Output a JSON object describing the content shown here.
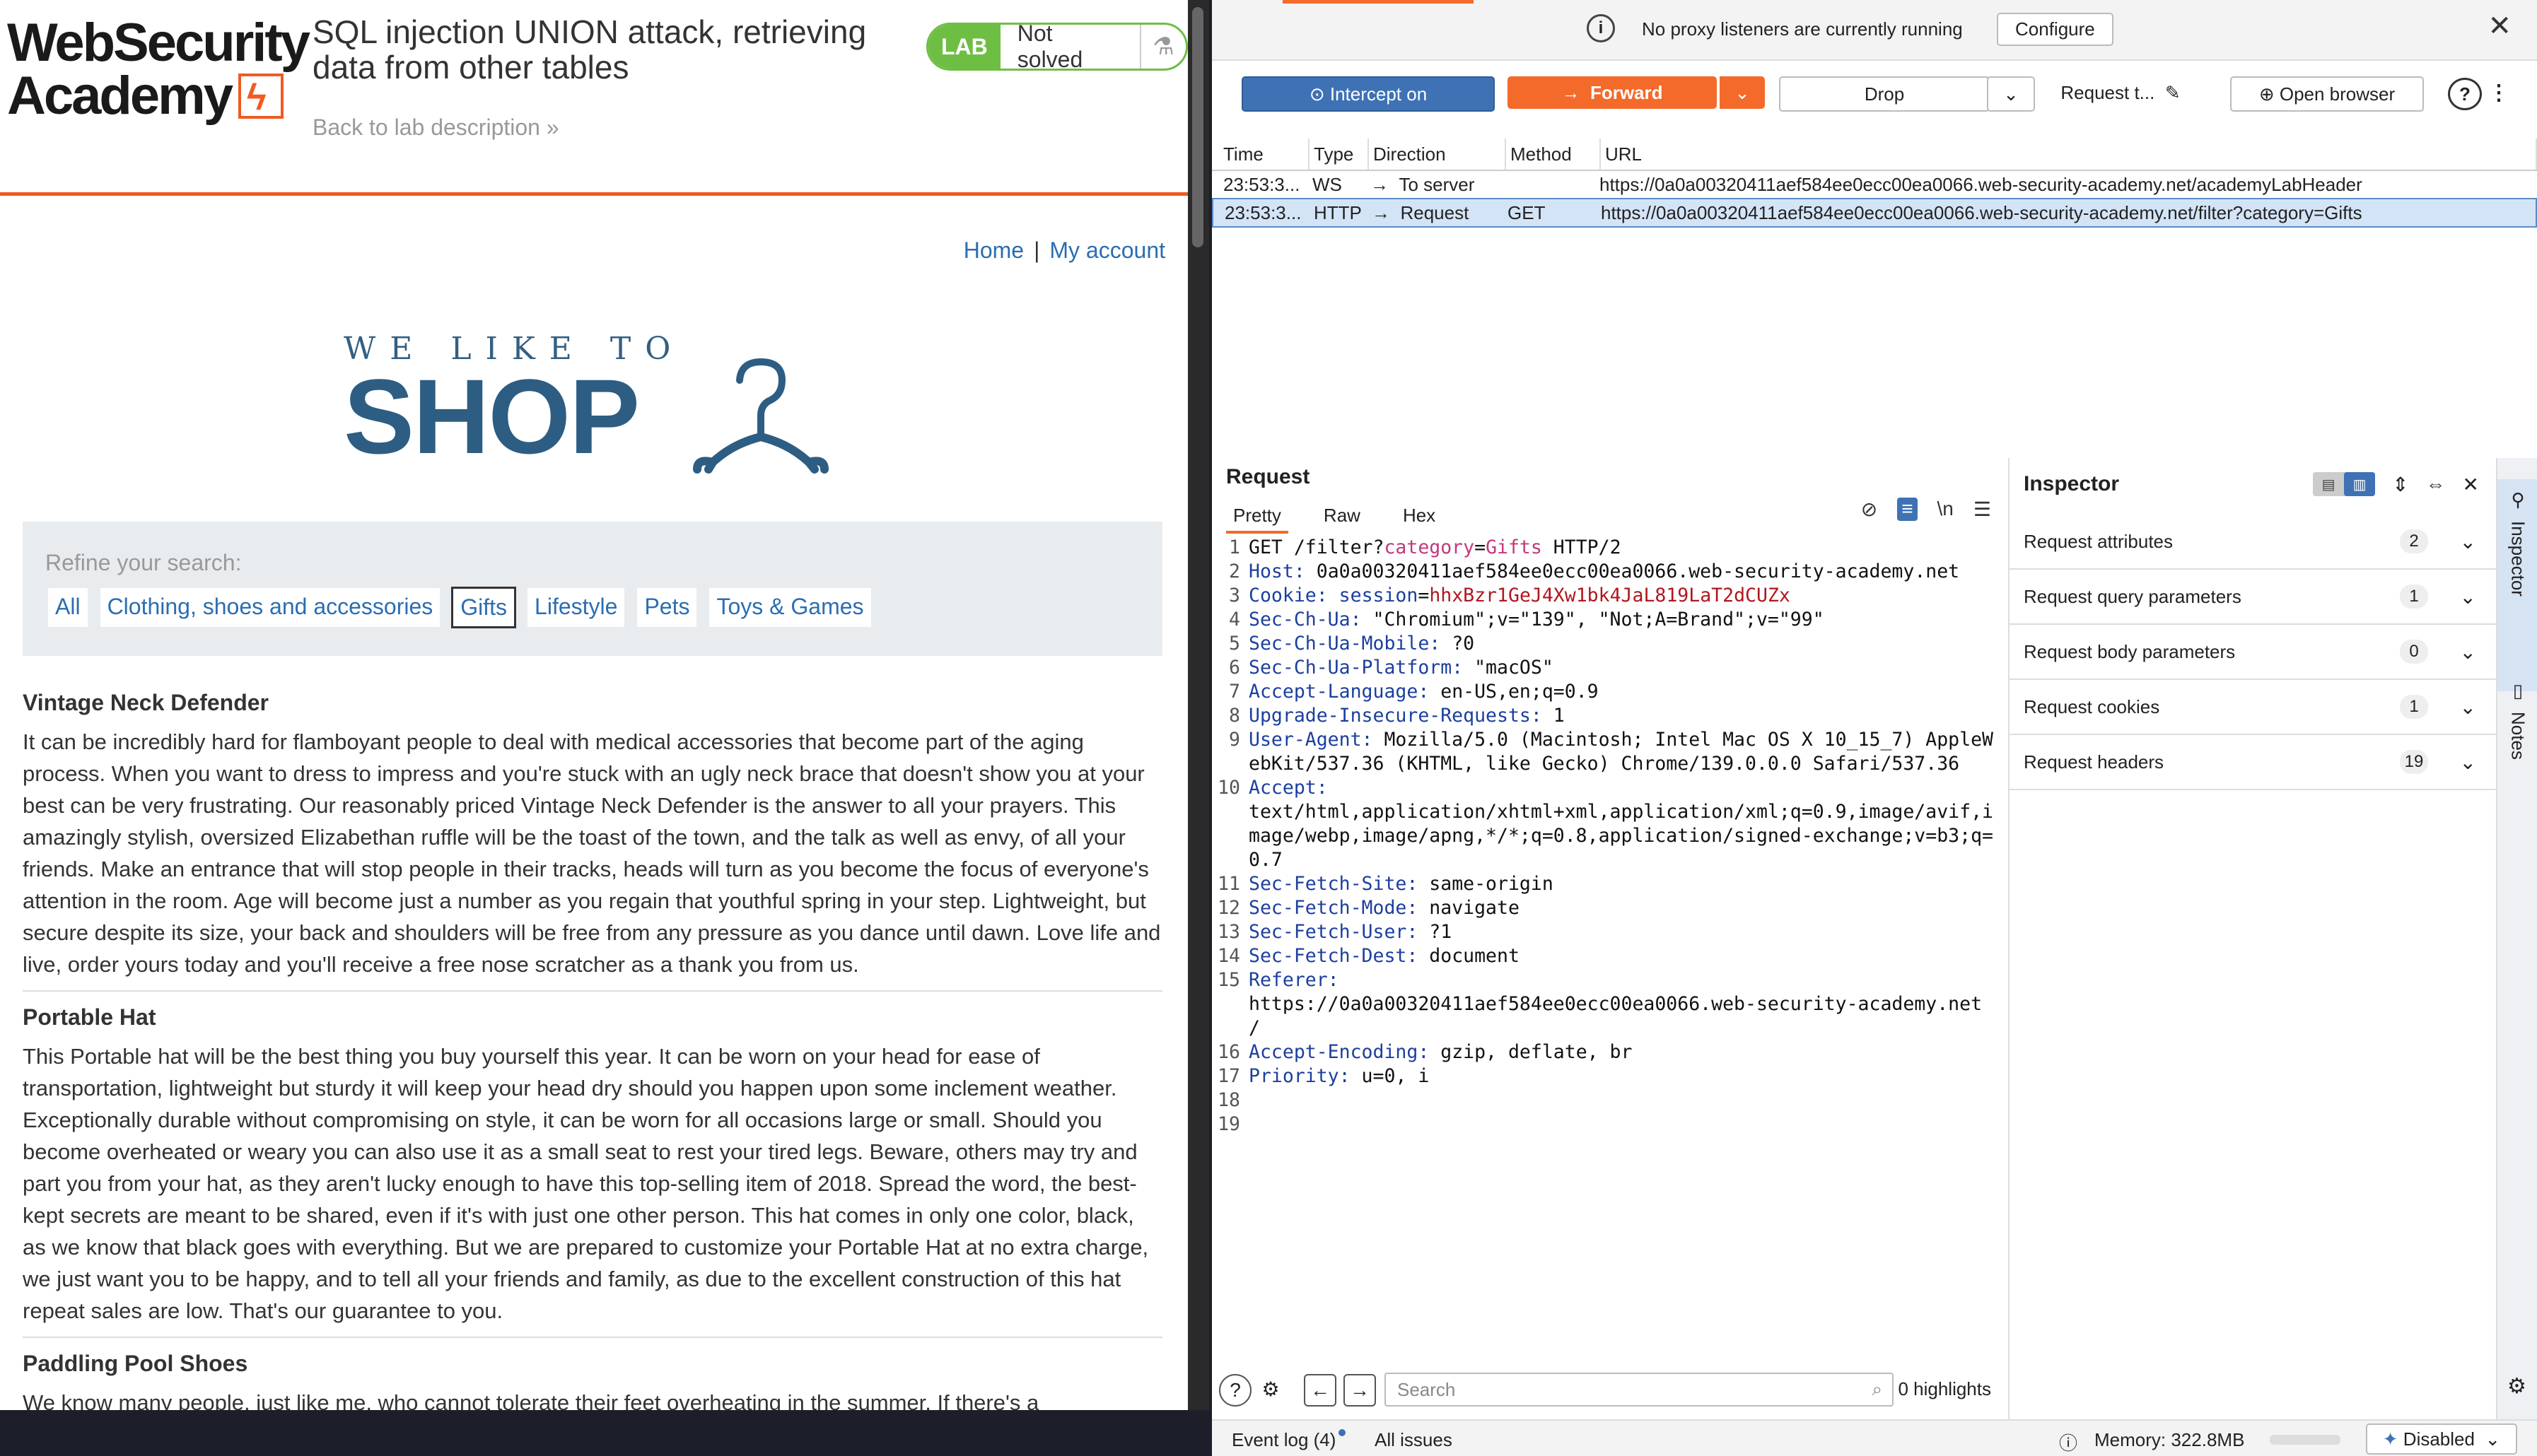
{
  "lab": {
    "logo_line1": "WebSecurity",
    "logo_line2": "Academy",
    "title": "SQL injection UNION attack, retrieving data from other tables",
    "back_link": "Back to lab description",
    "badge": "LAB",
    "status": "Not solved"
  },
  "shop": {
    "nav_home": "Home",
    "nav_separator": "|",
    "nav_account": "My account",
    "logo_small": "WE LIKE TO",
    "logo_big": "SHOP",
    "refine_label": "Refine your search:",
    "filters": [
      "All",
      "Clothing, shoes and accessories",
      "Gifts",
      "Lifestyle",
      "Pets",
      "Toys & Games"
    ],
    "active_filter": "Gifts",
    "products": [
      {
        "name": "Vintage Neck Defender",
        "description": "It can be incredibly hard for flamboyant people to deal with medical accessories that become part of the aging process. When you want to dress to impress and you're stuck with an ugly neck brace that doesn't show you at your best can be very frustrating. Our reasonably priced Vintage Neck Defender is the answer to all your prayers. This amazingly stylish, oversized Elizabethan ruffle will be the toast of the town, and the talk as well as envy, of all your friends. Make an entrance that will stop people in their tracks, heads will turn as you become the focus of everyone's attention in the room. Age will become just a number as you regain that youthful spring in your step. Lightweight, but secure despite its size, your back and shoulders will be free from any pressure as you dance until dawn. Love life and live, order yours today and you'll receive a free nose scratcher as a thank you from us."
      },
      {
        "name": "Portable Hat",
        "description": "This Portable hat will be the best thing you buy yourself this year. It can be worn on your head for ease of transportation, lightweight but sturdy it will keep your head dry should you happen upon some inclement weather. Exceptionally durable without compromising on style, it can be worn for all occasions large or small. Should you become overheated or weary you can also use it as a small seat to rest your tired legs. Beware, others may try and part you from your hat, as they aren't lucky enough to have this top-selling item of 2018. Spread the word, the best-kept secrets are meant to be shared, even if it's with just one other person. This hat comes in only one color, black, as we know that black goes with everything. But we are prepared to customize your Portable Hat at no extra charge, we just want you to be happy, and to tell all your friends and family, as due to the excellent construction of this hat repeat sales are low. That's our guarantee to you."
      },
      {
        "name": "Paddling Pool Shoes",
        "description": "We know many people, just like me, who cannot tolerate their feet overheating in the summer. If there's a"
      }
    ]
  },
  "burp": {
    "banner_text": "No proxy listeners are currently running",
    "configure_label": "Configure",
    "toolbar": {
      "intercept": "Intercept on",
      "forward": "Forward",
      "drop": "Drop",
      "request_to": "Request t...",
      "open_browser": "Open browser"
    },
    "history_columns": [
      "Time",
      "Type",
      "Direction",
      "Method",
      "URL"
    ],
    "history_rows": [
      {
        "time": "23:53:3...",
        "type": "WS",
        "direction": "To server",
        "method": "",
        "url": "https://0a0a00320411aef584ee0ecc00ea0066.web-security-academy.net/academyLabHeader"
      },
      {
        "time": "23:53:3...",
        "type": "HTTP",
        "direction": "Request",
        "method": "GET",
        "url": "https://0a0a00320411aef584ee0ecc00ea0066.web-security-academy.net/filter?category=Gifts"
      }
    ],
    "request": {
      "title": "Request",
      "tabs": [
        "Pretty",
        "Raw",
        "Hex"
      ],
      "active_tab": "Pretty",
      "newline_toggle": "\\n",
      "lines": [
        {
          "n": "1",
          "parts": [
            [
              "plain",
              "GET /filter?"
            ],
            [
              "qp",
              "category"
            ],
            [
              "plain",
              "="
            ],
            [
              "qp",
              "Gifts"
            ],
            [
              "plain",
              " HTTP/2"
            ]
          ]
        },
        {
          "n": "2",
          "parts": [
            [
              "hk",
              "Host:"
            ],
            [
              "plain",
              " 0a0a00320411aef584ee0ecc00ea0066.web-security-academy.net"
            ]
          ]
        },
        {
          "n": "3",
          "parts": [
            [
              "hk",
              "Cookie:"
            ],
            [
              "plain",
              " "
            ],
            [
              "hk",
              "session"
            ],
            [
              "plain",
              "="
            ],
            [
              "ck",
              "hhxBzr1GeJ4Xw1bk4JaL819LaT2dCUZx"
            ]
          ]
        },
        {
          "n": "4",
          "parts": [
            [
              "hk",
              "Sec-Ch-Ua:"
            ],
            [
              "plain",
              " \"Chromium\";v=\"139\", \"Not;A=Brand\";v=\"99\""
            ]
          ]
        },
        {
          "n": "5",
          "parts": [
            [
              "hk",
              "Sec-Ch-Ua-Mobile:"
            ],
            [
              "plain",
              " ?0"
            ]
          ]
        },
        {
          "n": "6",
          "parts": [
            [
              "hk",
              "Sec-Ch-Ua-Platform:"
            ],
            [
              "plain",
              " \"macOS\""
            ]
          ]
        },
        {
          "n": "7",
          "parts": [
            [
              "hk",
              "Accept-Language:"
            ],
            [
              "plain",
              " en-US,en;q=0.9"
            ]
          ]
        },
        {
          "n": "8",
          "parts": [
            [
              "hk",
              "Upgrade-Insecure-Requests:"
            ],
            [
              "plain",
              " 1"
            ]
          ]
        },
        {
          "n": "9",
          "parts": [
            [
              "hk",
              "User-Agent:"
            ],
            [
              "plain",
              " Mozilla/5.0 (Macintosh; Intel Mac OS X 10_15_7) AppleWebKit/537.36 (KHTML, like Gecko) Chrome/139.0.0.0 Safari/537.36"
            ]
          ]
        },
        {
          "n": "10",
          "parts": [
            [
              "hk",
              "Accept:"
            ],
            [
              "plain",
              "\ntext/html,application/xhtml+xml,application/xml;q=0.9,image/avif,image/webp,image/apng,*/*;q=0.8,application/signed-exchange;v=b3;q=0.7"
            ]
          ]
        },
        {
          "n": "11",
          "parts": [
            [
              "hk",
              "Sec-Fetch-Site:"
            ],
            [
              "plain",
              " same-origin"
            ]
          ]
        },
        {
          "n": "12",
          "parts": [
            [
              "hk",
              "Sec-Fetch-Mode:"
            ],
            [
              "plain",
              " navigate"
            ]
          ]
        },
        {
          "n": "13",
          "parts": [
            [
              "hk",
              "Sec-Fetch-User:"
            ],
            [
              "plain",
              " ?1"
            ]
          ]
        },
        {
          "n": "14",
          "parts": [
            [
              "hk",
              "Sec-Fetch-Dest:"
            ],
            [
              "plain",
              " document"
            ]
          ]
        },
        {
          "n": "15",
          "parts": [
            [
              "hk",
              "Referer:"
            ],
            [
              "plain",
              "\nhttps://0a0a00320411aef584ee0ecc00ea0066.web-security-academy.net\n/"
            ]
          ]
        },
        {
          "n": "16",
          "parts": [
            [
              "hk",
              "Accept-Encoding:"
            ],
            [
              "plain",
              " gzip, deflate, br"
            ]
          ]
        },
        {
          "n": "17",
          "parts": [
            [
              "hk",
              "Priority:"
            ],
            [
              "plain",
              " u=0, i"
            ]
          ]
        },
        {
          "n": "18",
          "parts": []
        },
        {
          "n": "19",
          "parts": []
        }
      ],
      "search_placeholder": "Search",
      "highlights": "0 highlights"
    },
    "inspector": {
      "title": "Inspector",
      "sections": [
        {
          "label": "Request attributes",
          "count": "2"
        },
        {
          "label": "Request query parameters",
          "count": "1"
        },
        {
          "label": "Request body parameters",
          "count": "0"
        },
        {
          "label": "Request cookies",
          "count": "1"
        },
        {
          "label": "Request headers",
          "count": "19"
        }
      ]
    },
    "side_tabs": [
      "Inspector",
      "Notes"
    ],
    "status": {
      "event_log": "Event log (4)",
      "all_issues": "All issues",
      "memory": "Memory: 322.8MB",
      "disabled": "Disabled"
    },
    "colors": {
      "accent": "#f36a2b",
      "intercept": "#3e72b4",
      "lab_green": "#6fbe44"
    }
  }
}
